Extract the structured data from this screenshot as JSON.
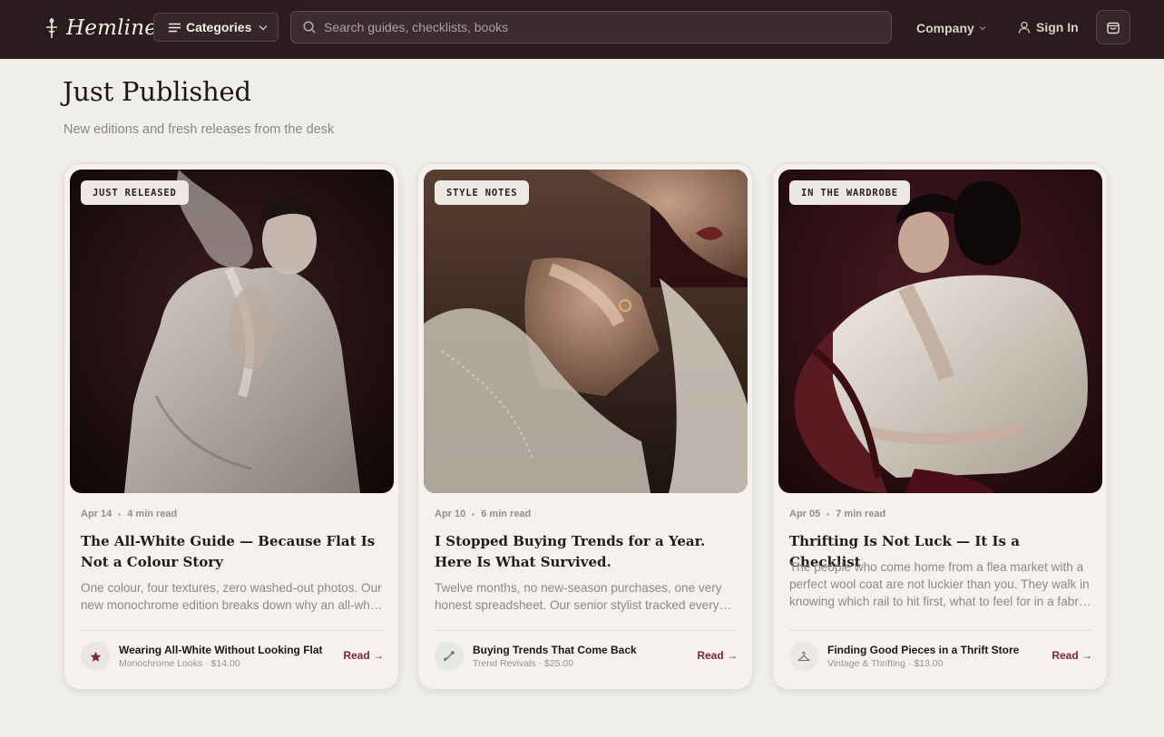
{
  "brand": {
    "name": "Hemline"
  },
  "nav": {
    "categories_label": "Categories",
    "search_placeholder": "Search guides, checklists, books",
    "company_label": "Company",
    "signin_label": "Sign In"
  },
  "section": {
    "title": "Just Published",
    "subtitle": "New editions and fresh releases from the desk"
  },
  "cards": [
    {
      "tag": "JUST RELEASED",
      "date": "Apr 14",
      "read_time": "4 min read",
      "title": "The All-White Guide — Because Flat Is Not a Colour Story",
      "excerpt": "One colour, four textures, zero washed-out photos. Our new monochrome edition breaks down why an all-white look falls flat and how to fix it.",
      "product_icon": "star-icon",
      "product_name": "Wearing All-White Without Looking Flat",
      "product_meta": "Monochrome Looks · $14.00",
      "cta": "Read →"
    },
    {
      "tag": "STYLE NOTES",
      "date": "Apr 10",
      "read_time": "6 min read",
      "title": "I Stopped Buying Trends for a Year. Here Is What Survived.",
      "excerpt": "Twelve months, no new-season purchases, one very honest spreadsheet. Our senior stylist tracked every piece she actually wore.",
      "product_icon": "needle-icon",
      "product_name": "Buying Trends That Come Back",
      "product_meta": "Trend Revivals · $25.00",
      "cta": "Read →"
    },
    {
      "tag": "IN THE WARDROBE",
      "date": "Apr 05",
      "read_time": "7 min read",
      "title": "Thrifting Is Not Luck — It Is a Checklist",
      "excerpt": "The people who come home from a flea market with a perfect wool coat are not luckier than you. They walk in knowing which rail to hit first, what to feel for in a fabric and when to walk away.",
      "product_icon": "hanger-icon",
      "product_name": "Finding Good Pieces in a Thrift Store",
      "product_meta": "Vintage & Thrifting · $13.00",
      "cta": "Read →"
    }
  ],
  "colors": {
    "header": "#2a1b1e",
    "accent": "#7b2937",
    "page": "#efeeea"
  }
}
